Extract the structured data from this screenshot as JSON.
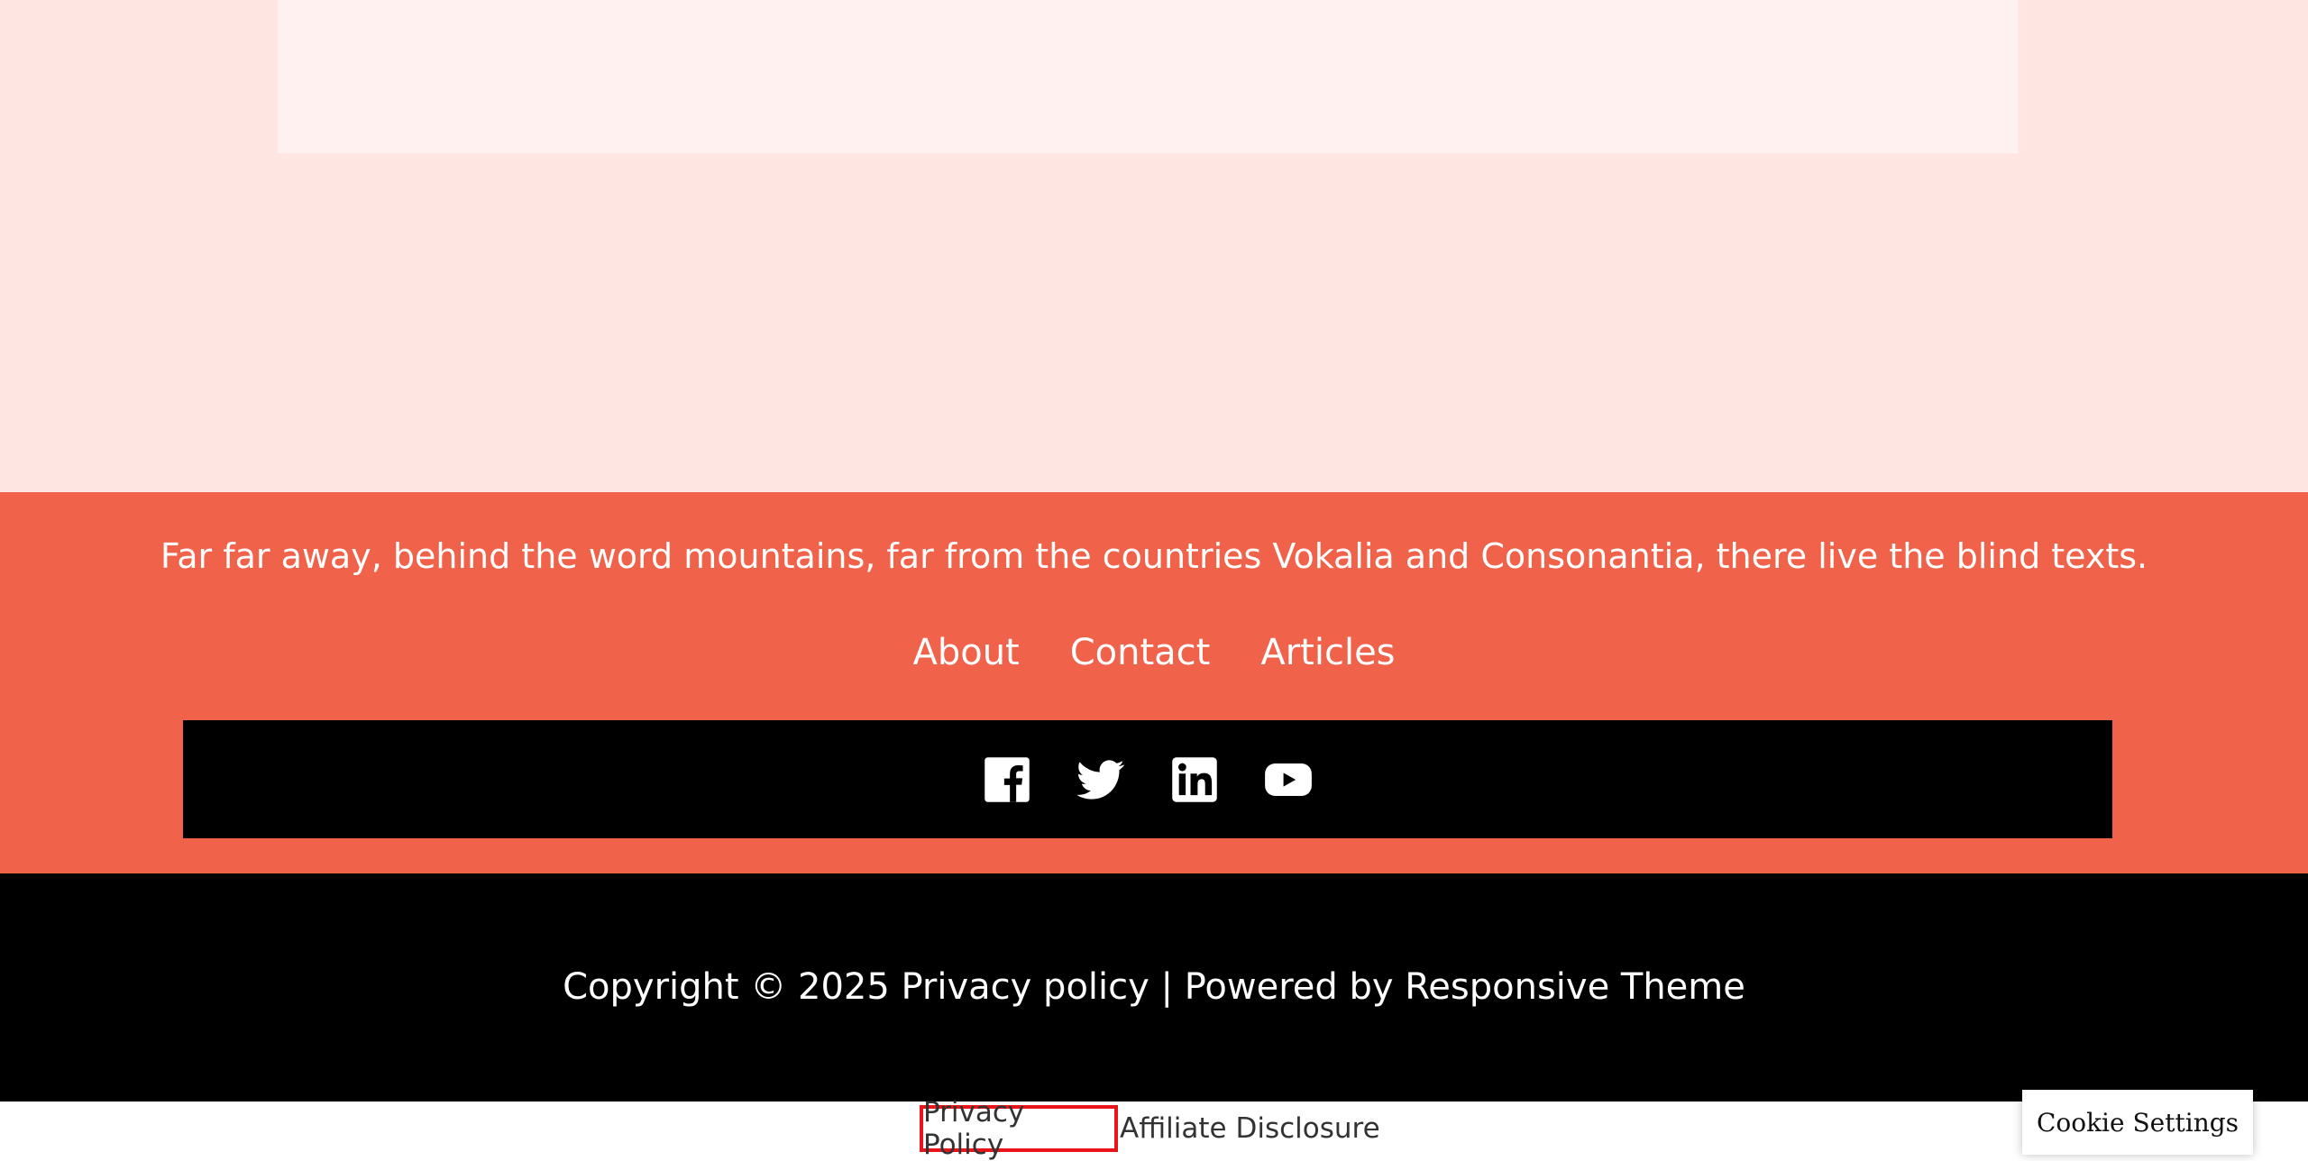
{
  "footer": {
    "tagline": "Far far away, behind the word mountains, far from the countries Vokalia and Consonantia, there live the blind texts.",
    "nav": {
      "about": "About",
      "contact": "Contact",
      "articles": "Articles"
    },
    "social": [
      {
        "name": "Facebook",
        "icon": "facebook-icon"
      },
      {
        "name": "Twitter",
        "icon": "twitter-icon"
      },
      {
        "name": "LinkedIn",
        "icon": "linkedin-icon"
      },
      {
        "name": "YouTube",
        "icon": "youtube-icon"
      }
    ],
    "copyright": {
      "prefix": "Copyright © 2025 ",
      "privacy_link": "Privacy policy",
      "separator": " | Powered by ",
      "theme_link": "Responsive Theme"
    }
  },
  "legal_bar": {
    "privacy_policy": "Privacy Policy",
    "affiliate_disclosure": "Affiliate Disclosure"
  },
  "cookie_settings": {
    "label": "Cookie Settings"
  },
  "colors": {
    "top_background": "#ffe6e3",
    "card_background": "#fff1f0",
    "footer_orange": "#f06249",
    "footer_black": "#000000",
    "highlight_border": "#e8141a"
  }
}
